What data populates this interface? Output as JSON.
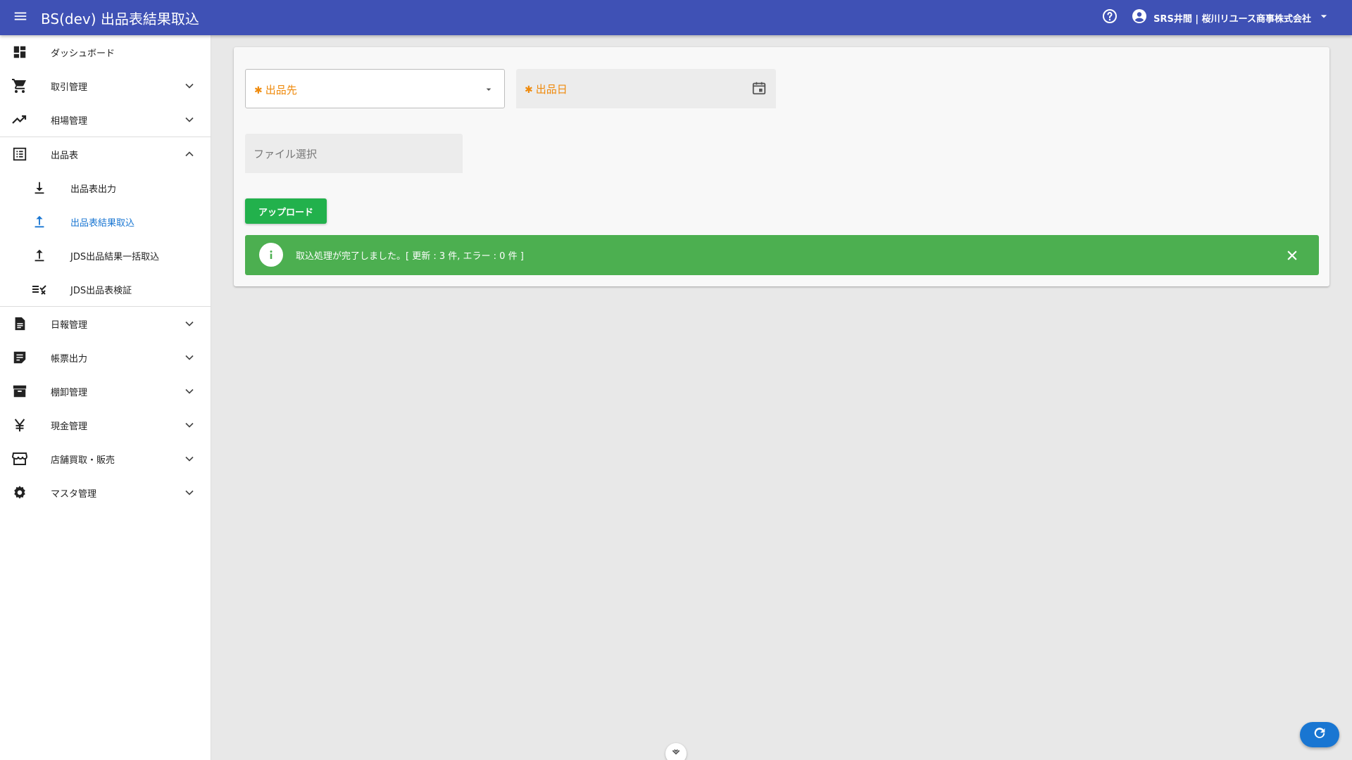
{
  "header": {
    "title": "BS(dev) 出品表結果取込",
    "user": "SRS井間 | 桜川リユース商事株式会社",
    "icons": {
      "menu": "menu-icon",
      "help": "help-circle-icon",
      "account": "account-circle-icon",
      "dropdown": "arrow-drop-down-icon"
    }
  },
  "sidebar": {
    "items": [
      {
        "label": "ダッシュボード",
        "icon": "dashboard-icon"
      },
      {
        "label": "取引管理",
        "icon": "cart-icon"
      },
      {
        "label": "相場管理",
        "icon": "trending-up-icon"
      },
      {
        "label": "出品表",
        "icon": "list-icon",
        "expanded": true
      },
      {
        "label": "日報管理",
        "icon": "document-icon"
      },
      {
        "label": "帳票出力",
        "icon": "note-icon"
      },
      {
        "label": "棚卸管理",
        "icon": "archive-icon"
      },
      {
        "label": "現金管理",
        "icon": "yen-icon"
      },
      {
        "label": "店舗買取・販売",
        "icon": "store-icon"
      },
      {
        "label": "マスタ管理",
        "icon": "gear-icon"
      }
    ],
    "subitems": [
      {
        "label": "出品表出力",
        "icon": "download-icon"
      },
      {
        "label": "出品表結果取込",
        "icon": "upload-icon",
        "active": true
      },
      {
        "label": "JDS出品結果一括取込",
        "icon": "upload-icon"
      },
      {
        "label": "JDS出品表検証",
        "icon": "checklist-icon"
      }
    ]
  },
  "form": {
    "destination_label": "出品先",
    "date_label": "出品日",
    "file_placeholder": "ファイル選択",
    "required_mark": "✱",
    "upload_label": "アップロード"
  },
  "alert": {
    "message": "取込処理が完了しました。[ 更新 : 3 件, エラー : 0 件 ]"
  },
  "colors": {
    "appbar": "#3f51b5",
    "active": "#1976d2",
    "required": "#ef8a0c",
    "upload": "#22b14c",
    "success": "#4caf50"
  }
}
